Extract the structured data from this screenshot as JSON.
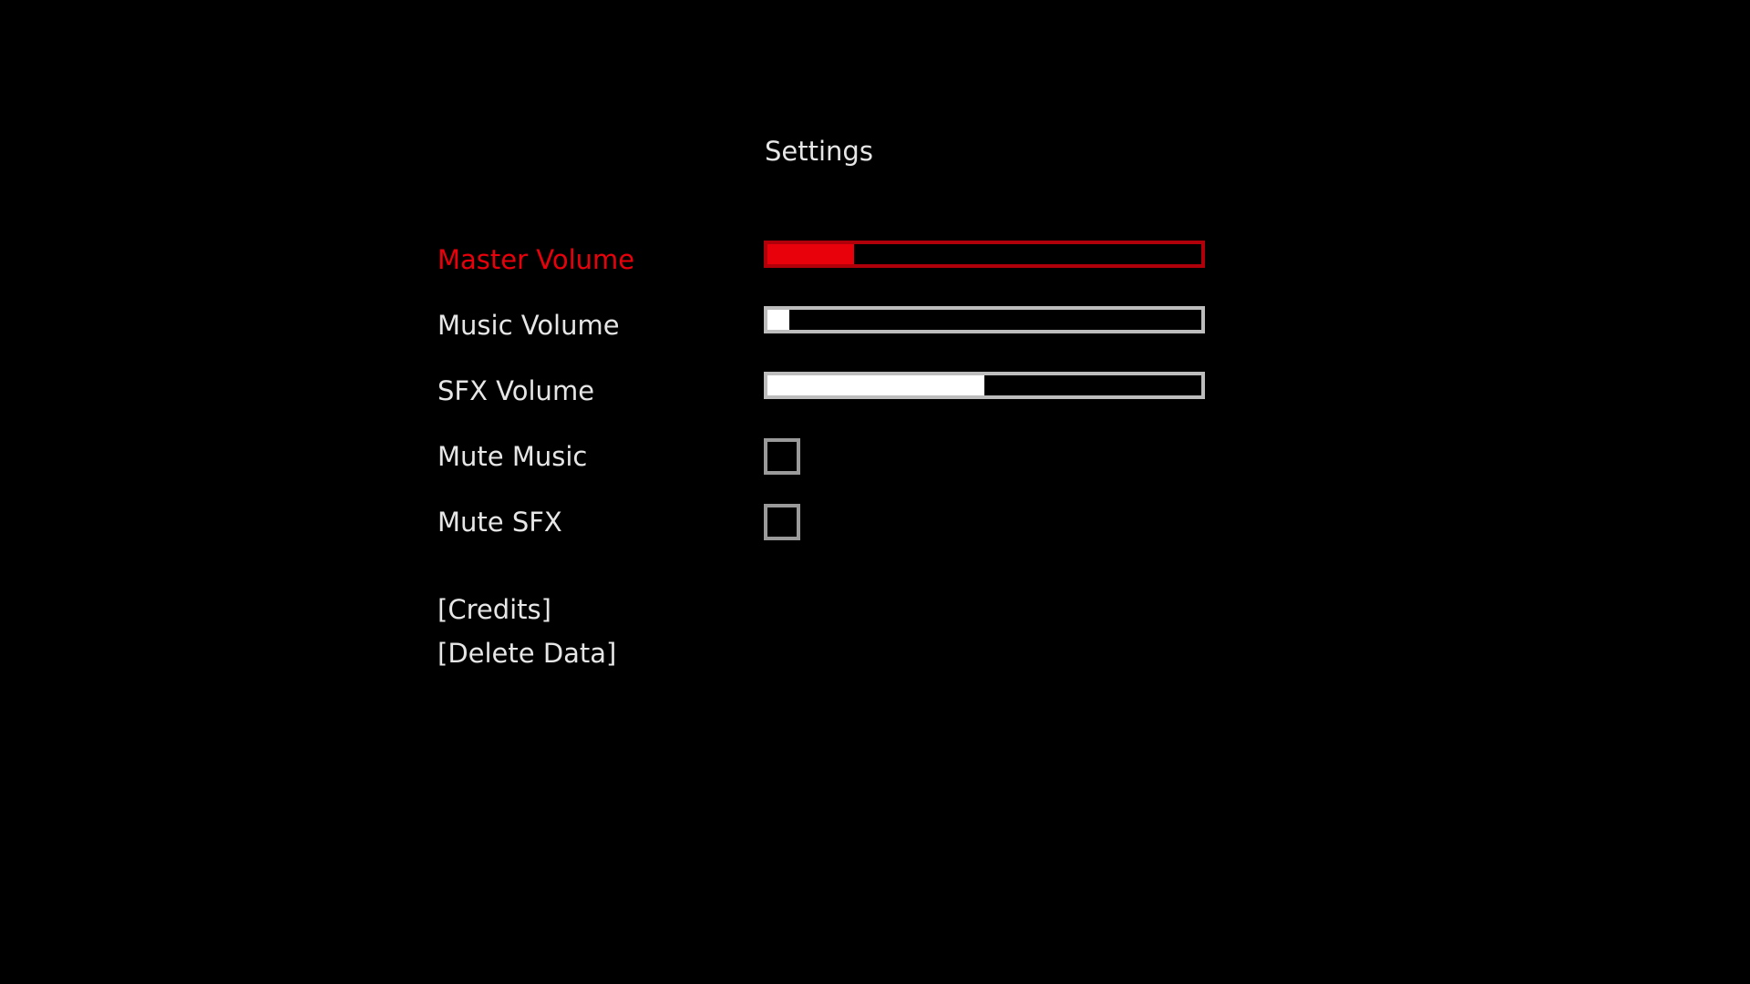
{
  "colors": {
    "background": "#000000",
    "text": "#e6e6e6",
    "selected": "#e8000b",
    "selected_track_border": "#b0000a",
    "track_border": "#bdbdbd",
    "fill": "#ffffff",
    "checkbox_border": "#9a9a9a"
  },
  "settings": {
    "title": "Settings",
    "rows": [
      {
        "label": "Master Volume",
        "type": "slider",
        "value": 0.2,
        "selected": true
      },
      {
        "label": "Music Volume",
        "type": "slider",
        "value": 0.05,
        "selected": false
      },
      {
        "label": "SFX Volume",
        "type": "slider",
        "value": 0.5,
        "selected": false
      },
      {
        "label": "Mute Music",
        "type": "checkbox",
        "checked": false,
        "selected": false
      },
      {
        "label": "Mute SFX",
        "type": "checkbox",
        "checked": false,
        "selected": false
      }
    ],
    "links": {
      "credits": "[Credits]",
      "delete_data": "[Delete Data]"
    }
  }
}
